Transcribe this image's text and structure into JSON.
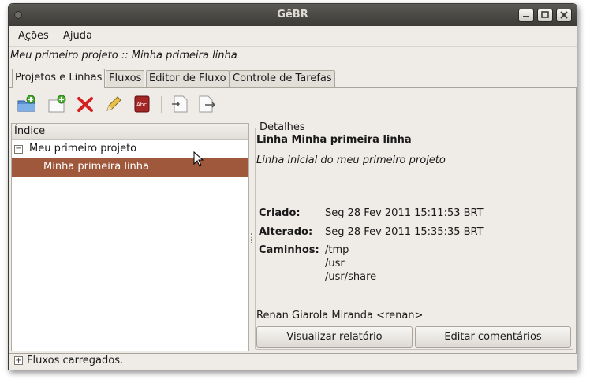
{
  "window": {
    "title": "GêBR"
  },
  "menu": {
    "acoes_prefix": "A",
    "acoes_mnemonic": "ç",
    "acoes_suffix": "ões",
    "ajuda_prefix": "A",
    "ajuda_mnemonic": "j",
    "ajuda_suffix": "uda"
  },
  "breadcrumb": "Meu primeiro projeto :: Minha primeira linha",
  "tabs": [
    "Projetos e Linhas",
    "Fluxos",
    "Editor de Fluxo",
    "Controle de Tarefas"
  ],
  "toolbar": {
    "icons": [
      "new-project-icon",
      "new-line-icon",
      "delete-icon",
      "edit-properties-icon",
      "dictionary-icon",
      "import-icon",
      "export-icon"
    ]
  },
  "tree": {
    "header": "Índice",
    "project": {
      "label": "Meu primeiro projeto",
      "expander": "−"
    },
    "line": {
      "label": "Minha primeira linha"
    }
  },
  "details": {
    "legend": "Detalhes",
    "title": "Linha Minha primeira linha",
    "description": "Linha inicial do meu primeiro projeto",
    "created_label": "Criado:",
    "created_value": "Seg 28 Fev 2011 15:11:53 BRT",
    "modified_label": "Alterado:",
    "modified_value": "Seg 28 Fev 2011 15:35:35 BRT",
    "paths_label": "Caminhos:",
    "paths": [
      "/tmp",
      "/usr",
      "/usr/share"
    ],
    "author": "Renan Giarola Miranda <renan>",
    "report_button": "Visualizar relatório",
    "comments_button": "Editar comentários"
  },
  "status": {
    "expander": "+",
    "text": "Fluxos carregados."
  },
  "colors": {
    "selection": "#a0583c",
    "titlebar": "#3c3b37",
    "window_bg": "#efebe7"
  }
}
